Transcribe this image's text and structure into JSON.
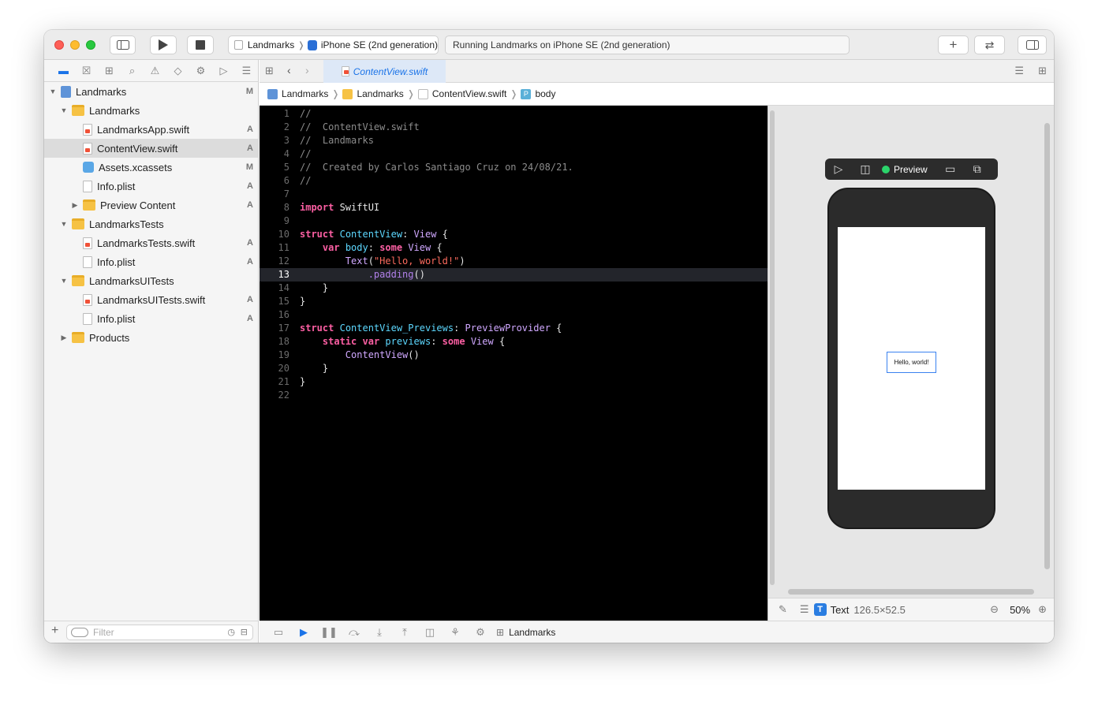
{
  "toolbar": {
    "scheme_project": "Landmarks",
    "scheme_device": "iPhone SE (2nd generation)",
    "status_text": "Running Landmarks on iPhone SE (2nd generation)"
  },
  "navigator": {
    "items": [
      {
        "label": "Landmarks",
        "badge": "M"
      },
      {
        "label": "Landmarks",
        "badge": ""
      },
      {
        "label": "LandmarksApp.swift",
        "badge": "A"
      },
      {
        "label": "ContentView.swift",
        "badge": "A"
      },
      {
        "label": "Assets.xcassets",
        "badge": "M"
      },
      {
        "label": "Info.plist",
        "badge": "A"
      },
      {
        "label": "Preview Content",
        "badge": "A"
      },
      {
        "label": "LandmarksTests",
        "badge": ""
      },
      {
        "label": "LandmarksTests.swift",
        "badge": "A"
      },
      {
        "label": "Info.plist",
        "badge": "A"
      },
      {
        "label": "LandmarksUITests",
        "badge": ""
      },
      {
        "label": "LandmarksUITests.swift",
        "badge": "A"
      },
      {
        "label": "Info.plist",
        "badge": "A"
      },
      {
        "label": "Products",
        "badge": ""
      }
    ],
    "filter_placeholder": "Filter"
  },
  "editor": {
    "tab_label": "ContentView.swift",
    "jump": [
      "Landmarks",
      "Landmarks",
      "ContentView.swift",
      "body"
    ],
    "current_line": 13,
    "lines": [
      "//",
      "//  ContentView.swift",
      "//  Landmarks",
      "//",
      "//  Created by Carlos Santiago Cruz on 24/08/21.",
      "//",
      "",
      "import SwiftUI",
      "",
      "struct ContentView: View {",
      "    var body: some View {",
      "        Text(\"Hello, world!\")",
      "            .padding()",
      "    }",
      "}",
      "",
      "struct ContentView_Previews: PreviewProvider {",
      "    static var previews: some View {",
      "        ContentView()",
      "    }",
      "}",
      ""
    ]
  },
  "canvas": {
    "preview_label": "Preview",
    "preview_text": "Hello, world!",
    "inspector_type": "Text",
    "inspector_size": "126.5×52.5",
    "zoom": "50%"
  },
  "debug": {
    "target": "Landmarks"
  },
  "colors": {
    "accent": "#1a73e8",
    "editor_bg": "#000000",
    "keyword": "#fc5fa3",
    "type": "#5dd8ff",
    "string": "#fc6a5d"
  }
}
